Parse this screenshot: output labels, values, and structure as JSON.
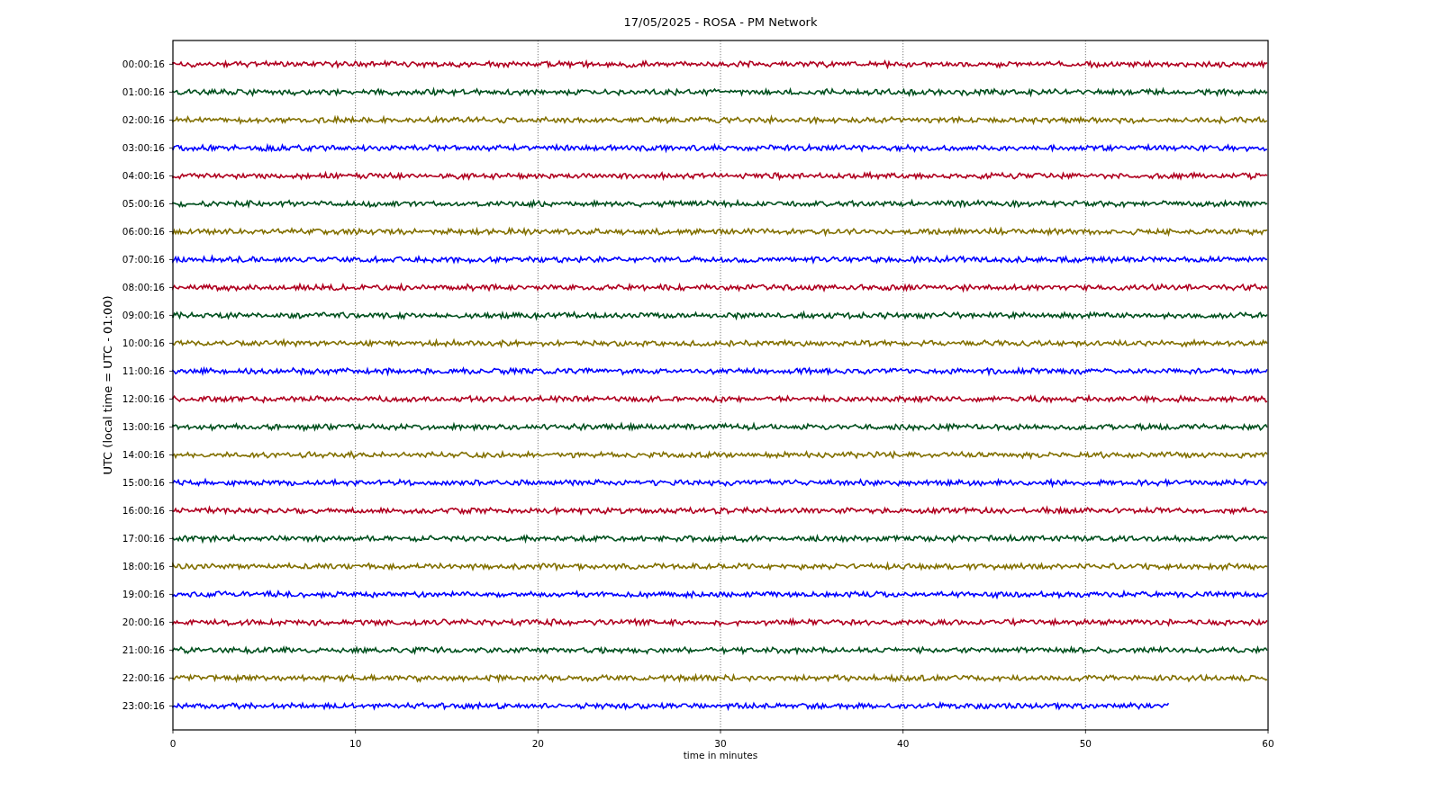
{
  "title": "17/05/2025 - ROSA - PM Network",
  "ylabel": "UTC (local time = UTC - 01:00)",
  "xlabel": "time in minutes",
  "xticks": [
    "0",
    "10",
    "20",
    "30",
    "40",
    "50",
    "60"
  ],
  "rows": [
    {
      "label": "00:00:16",
      "color": "#b00020",
      "level": 1
    },
    {
      "label": "01:00:16",
      "color": "#00501e",
      "level": 1
    },
    {
      "label": "02:00:16",
      "color": "#827000",
      "level": 1
    },
    {
      "label": "03:00:16",
      "color": "#0000ff",
      "level": 1
    },
    {
      "label": "04:00:16",
      "color": "#b00020",
      "level": 1
    },
    {
      "label": "05:00:16",
      "color": "#00501e",
      "level": 1
    },
    {
      "label": "06:00:16",
      "color": "#827000",
      "level": 1
    },
    {
      "label": "07:00:16",
      "color": "#0000ff",
      "level": 1
    },
    {
      "label": "08:00:16",
      "color": "#b00020",
      "level": 1
    },
    {
      "label": "09:00:16",
      "color": "#00501e",
      "level": 1
    },
    {
      "label": "10:00:16",
      "color": "#827000",
      "level": 1
    },
    {
      "label": "11:00:16",
      "color": "#0000ff",
      "level": 1
    },
    {
      "label": "12:00:16",
      "color": "#b00020",
      "level": 1
    },
    {
      "label": "13:00:16",
      "color": "#00501e",
      "level": 1
    },
    {
      "label": "14:00:16",
      "color": "#827000",
      "level": 1
    },
    {
      "label": "15:00:16",
      "color": "#0000ff",
      "level": 1
    },
    {
      "label": "16:00:16",
      "color": "#b00020",
      "level": 1
    },
    {
      "label": "17:00:16",
      "color": "#00501e",
      "level": 1
    },
    {
      "label": "18:00:16",
      "color": "#827000",
      "level": 1
    },
    {
      "label": "19:00:16",
      "color": "#0000ff",
      "level": 1
    },
    {
      "label": "20:00:16",
      "color": "#b00020",
      "level": 1
    },
    {
      "label": "21:00:16",
      "color": "#00501e",
      "level": 1
    },
    {
      "label": "22:00:16",
      "color": "#827000",
      "level": 1
    },
    {
      "label": "23:00:16",
      "color": "#0000ff",
      "level": 0.91
    }
  ]
}
